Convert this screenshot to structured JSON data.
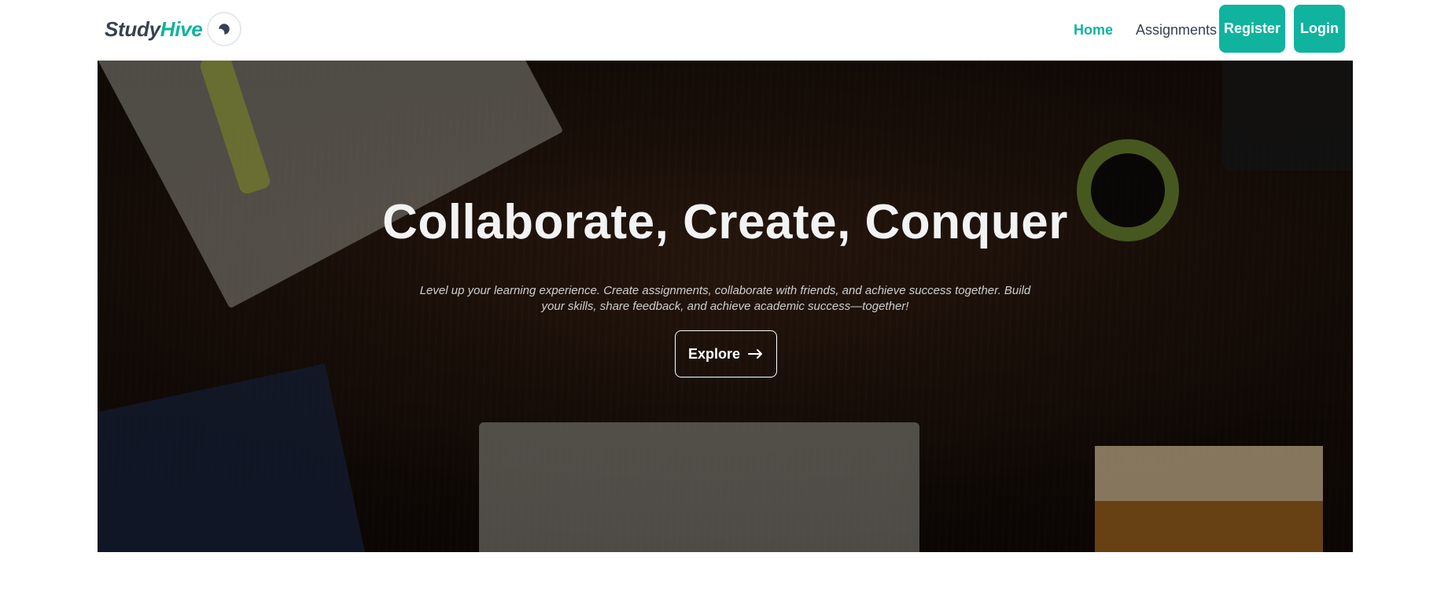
{
  "brand": {
    "part1": "Study",
    "part2": "Hive"
  },
  "nav": {
    "theme_icon": "moon-icon",
    "links": [
      {
        "label": "Home",
        "active": true
      },
      {
        "label": "Assignments",
        "active": false
      }
    ],
    "register_label": "Register",
    "login_label": "Login"
  },
  "hero": {
    "title": "Collaborate, Create, Conquer",
    "subtitle": "Level up your learning experience. Create assignments, collaborate with friends, and achieve success together. Build your skills, share feedback, and achieve academic success—together!",
    "button_label": "Explore",
    "button_icon": "arrow-right-icon"
  },
  "colors": {
    "accent": "#10b39e",
    "text": "#374151"
  }
}
